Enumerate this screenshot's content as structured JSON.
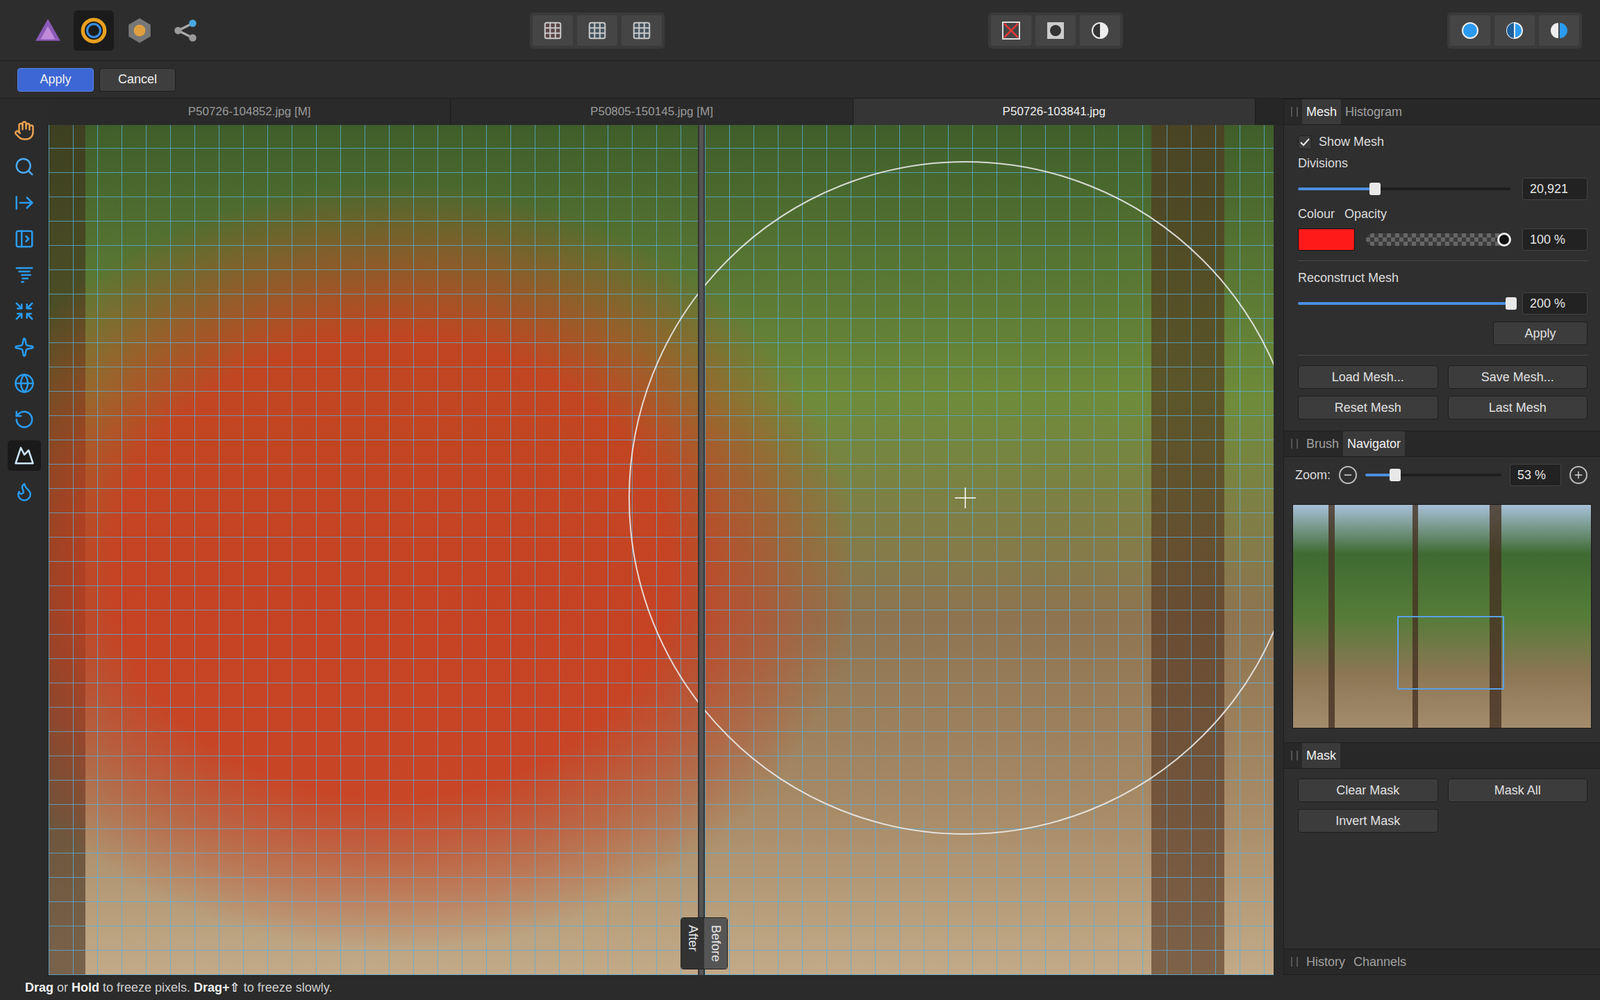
{
  "personas": [
    {
      "selected": false
    },
    {
      "selected": true
    },
    {
      "selected": false
    },
    {
      "selected": false
    }
  ],
  "context_bar": {
    "buttons": [
      {
        "label": "Apply",
        "primary": true
      },
      {
        "label": "Cancel",
        "primary": false
      }
    ]
  },
  "tools": [
    {
      "selected": false
    },
    {
      "selected": false
    },
    {
      "selected": false
    },
    {
      "selected": false
    },
    {
      "selected": false
    },
    {
      "selected": false
    },
    {
      "selected": false
    },
    {
      "selected": false
    },
    {
      "selected": false
    },
    {
      "selected": true
    },
    {
      "selected": false
    }
  ],
  "document_tabs": [
    {
      "label": "P50726-104852.jpg [M]",
      "selected": false
    },
    {
      "label": "P50805-150145.jpg [M]",
      "selected": false
    },
    {
      "label": "P50726-103841.jpg",
      "selected": true
    }
  ],
  "canvas": {
    "split_labels": [
      "After",
      "Before"
    ]
  },
  "mesh_panel": {
    "tabs": [
      {
        "label": "Mesh",
        "selected": true
      },
      {
        "label": "Histogram",
        "selected": false
      }
    ],
    "show_mesh": {
      "label": "Show Mesh",
      "checked": true
    },
    "divisions": {
      "label": "Divisions",
      "level": 0.36,
      "value": "20,921"
    },
    "colour": {
      "label": "Colour",
      "color": "#ff1a1a"
    },
    "opacity": {
      "label": "Opacity",
      "level": 1,
      "value": "100 %"
    },
    "reconstruct": {
      "label": "Reconstruct Mesh",
      "level": 1,
      "value": "200 %",
      "button": "Apply"
    },
    "buttons": [
      [
        "Load Mesh...",
        "Save Mesh..."
      ],
      [
        "Reset Mesh",
        "Last Mesh"
      ]
    ]
  },
  "navigator_panel": {
    "tabs": [
      {
        "label": "Brush",
        "selected": false
      },
      {
        "label": "Navigator",
        "selected": true
      }
    ],
    "zoom": {
      "label": "Zoom:",
      "level": 0.22,
      "value": "53 %"
    }
  },
  "mask_panel": {
    "tabs": [
      {
        "label": "Mask",
        "selected": true
      }
    ],
    "buttons": [
      [
        "Clear Mask",
        "Mask All"
      ],
      [
        "Invert Mask"
      ]
    ]
  },
  "bottom_tabs": [
    {
      "label": "History",
      "selected": false
    },
    {
      "label": "Channels",
      "selected": false
    }
  ],
  "status_bar": [
    {
      "text": "Drag",
      "bold": true
    },
    {
      "text": " or ",
      "bold": false
    },
    {
      "text": "Hold",
      "bold": true
    },
    {
      "text": " to freeze pixels. ",
      "bold": false
    },
    {
      "text": "Drag+⇧",
      "bold": true
    },
    {
      "text": " to freeze slowly.",
      "bold": false
    }
  ]
}
